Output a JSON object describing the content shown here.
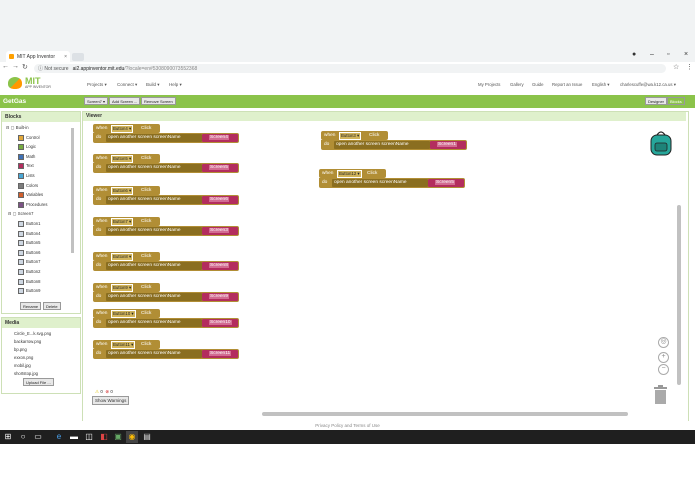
{
  "browser": {
    "tab_title": "MIT App Inventor",
    "tab_close": "×",
    "not_secure": "ⓘ Not secure",
    "url": "ai2.appinventor.mit.edu",
    "url_rest": "/?locale=en#5308090073552368"
  },
  "app": {
    "logo_title": "MIT",
    "logo_sub": "APP INVENTOR",
    "menus": [
      "Projects ▾",
      "Connect ▾",
      "Build ▾",
      "Help ▾"
    ],
    "right_menus": [
      "My Projects",
      "Gallery",
      "Guide",
      "Report an Issue",
      "English ▾",
      "charlescuffe@wa.k12.ca.us ▾"
    ]
  },
  "project": {
    "name": "GetGas",
    "screen_dropdown": "Screen7 ▾",
    "add_screen": "Add Screen ...",
    "remove_screen": "Remove Screen",
    "designer": "Designer",
    "blocks": "Blocks"
  },
  "blocks_panel": {
    "title": "Blocks",
    "builtin": "Built-in",
    "builtin_items": [
      {
        "label": "Control",
        "color": "#e1a83b"
      },
      {
        "label": "Logic",
        "color": "#77ab41"
      },
      {
        "label": "Math",
        "color": "#3f71b5"
      },
      {
        "label": "Text",
        "color": "#b32d5e"
      },
      {
        "label": "Lists",
        "color": "#49a6d4"
      },
      {
        "label": "Colors",
        "color": "#7d7d7d"
      },
      {
        "label": "Variables",
        "color": "#d05f2d"
      },
      {
        "label": "Procedures",
        "color": "#7c5385"
      }
    ],
    "screen": "Screen7",
    "components": [
      "Button1",
      "Button4",
      "Button5",
      "Button6",
      "Button7",
      "Button2",
      "Button8",
      "Button9"
    ],
    "rename": "Rename",
    "delete": "Delete"
  },
  "media_panel": {
    "title": "Media",
    "files": [
      "Circle_E...k.svg.png",
      "backarrow.png",
      "bp.png",
      "exxon.png",
      "mobil.jpg",
      "shortstop.jpg"
    ],
    "upload": "Upload File ..."
  },
  "viewer": {
    "title": "Viewer",
    "when": "when",
    "click": "Click",
    "do": "do",
    "action": "open another screen  screenName",
    "blocks_left": [
      {
        "comp": "Button4 ▾",
        "screen": "Screen4"
      },
      {
        "comp": "Button5 ▾",
        "screen": "Screen5"
      },
      {
        "comp": "Button6 ▾",
        "screen": "Screen6"
      },
      {
        "comp": "Button7 ▾",
        "screen": "Screen3"
      },
      {
        "comp": "Button8 ▾",
        "screen": "Screen8"
      },
      {
        "comp": "Button9 ▾",
        "screen": "Screen9"
      },
      {
        "comp": "Button10 ▾",
        "screen": "Screen10"
      },
      {
        "comp": "Button11 ▾",
        "screen": "Screen11"
      }
    ],
    "blocks_right": [
      {
        "comp": "Button3 ▾",
        "screen": "Screen1"
      },
      {
        "comp": "Button12 ▾",
        "screen": "Screen5"
      }
    ],
    "warn_count": "0",
    "error_count": "0",
    "show_warnings": "Show Warnings"
  },
  "footer": "Privacy Policy and Terms of Use"
}
